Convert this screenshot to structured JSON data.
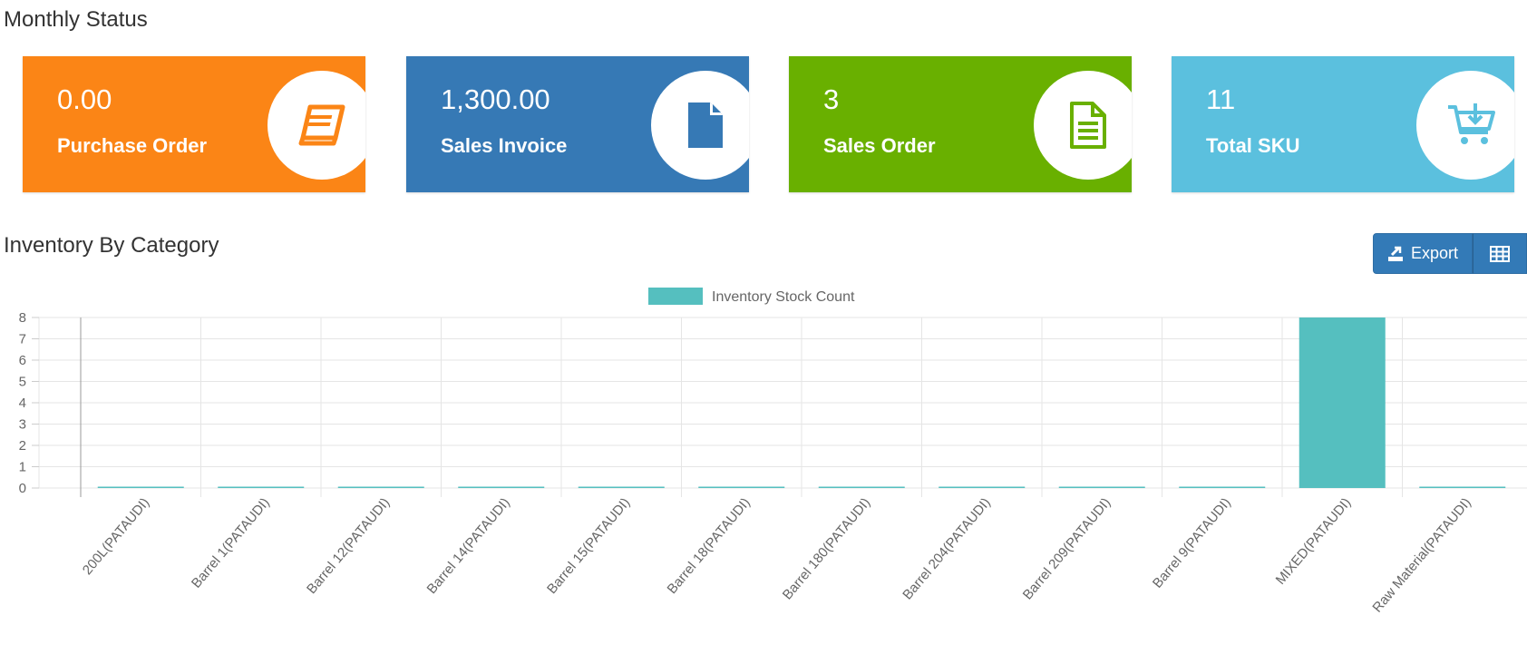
{
  "monthly_status": {
    "title": "Monthly Status",
    "cards": [
      {
        "value": "0.00",
        "label": "Purchase Order",
        "icon": "book-icon",
        "color": "#fb8516"
      },
      {
        "value": "1,300.00",
        "label": "Sales Invoice",
        "icon": "file-icon",
        "color": "#3679b5"
      },
      {
        "value": "3",
        "label": "Sales Order",
        "icon": "file-text-icon",
        "color": "#69b000"
      },
      {
        "value": "11",
        "label": "Total SKU",
        "icon": "cart-download-icon",
        "color": "#5bc0de"
      }
    ]
  },
  "inventory": {
    "title": "Inventory By Category",
    "export_label": "Export"
  },
  "chart_data": {
    "type": "bar",
    "legend_position": "top",
    "grid": true,
    "categories": [
      "200L(PATAUDI)",
      "Barrel 1(PATAUDI)",
      "Barrel 12(PATAUDI)",
      "Barrel 14(PATAUDI)",
      "Barrel 15(PATAUDI)",
      "Barrel 18(PATAUDI)",
      "Barrel 180(PATAUDI)",
      "Barrel 204(PATAUDI)",
      "Barrel 209(PATAUDI)",
      "Barrel 9(PATAUDI)",
      "MIXED(PATAUDI)",
      "Raw Material(PATAUDI)"
    ],
    "series": [
      {
        "name": "Inventory Stock Count",
        "color": "#55bfbf",
        "values": [
          0,
          0,
          0,
          0,
          0,
          0,
          0,
          0,
          0,
          0,
          8,
          0
        ]
      }
    ],
    "ylim": [
      0,
      8
    ],
    "yticks": [
      0,
      1,
      2,
      3,
      4,
      5,
      6,
      7,
      8
    ]
  }
}
